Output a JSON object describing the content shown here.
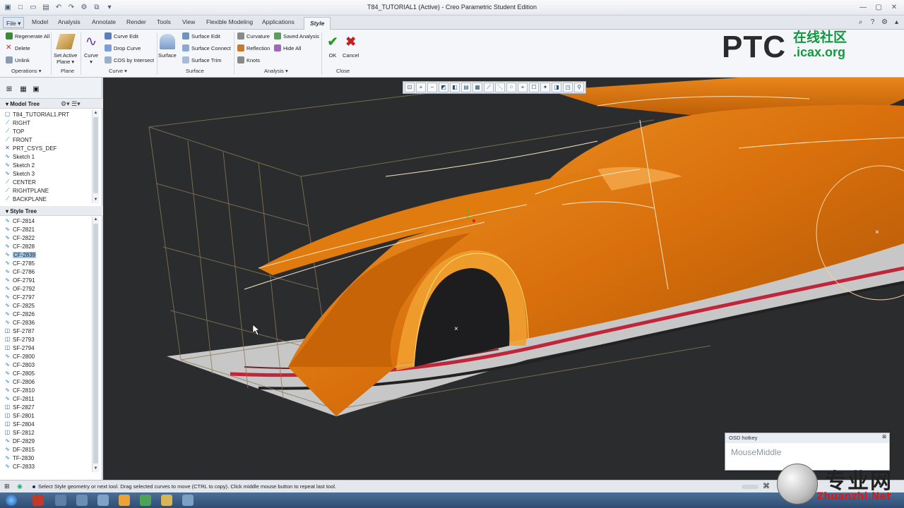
{
  "window": {
    "title": "T84_TUTORIAL1 (Active) - Creo Parametric Student Edition"
  },
  "tabs": [
    "File",
    "Model",
    "Analysis",
    "Annotate",
    "Render",
    "Tools",
    "View",
    "Flexible Modeling",
    "Applications",
    "Style"
  ],
  "active_tab": "Style",
  "ribbon": {
    "operations": {
      "label": "Operations",
      "items": [
        "Regenerate All",
        "Delete",
        "Unlink"
      ]
    },
    "plane": {
      "label": "Plane",
      "set_active": "Set Active",
      "set_active2": "Plane"
    },
    "curve": {
      "label": "Curve",
      "big": "Curve",
      "items": [
        "Curve Edit",
        "Drop Curve",
        "COS by Intersect"
      ]
    },
    "surface": {
      "label": "Surface",
      "big": "Surface",
      "items": [
        "Surface Edit",
        "Surface Connect",
        "Surface Trim"
      ]
    },
    "analysis": {
      "label": "Analysis",
      "items": [
        "Curvature",
        "Saved Analysis",
        "Reflection",
        "Hide All",
        "Knots"
      ]
    },
    "close": {
      "label": "Close",
      "ok": "OK",
      "cancel": "Cancel"
    }
  },
  "logo": {
    "ptc": "PTC",
    "cn1": "在线社区",
    "cn2": ".icax.org"
  },
  "model_tree": {
    "title": "Model Tree",
    "items": [
      "T84_TUTORIAL1.PRT",
      "RIGHT",
      "TOP",
      "FRONT",
      "PRT_CSYS_DEF",
      "Sketch 1",
      "Sketch 2",
      "Sketch 3",
      "CENTER",
      "RIGHTPLANE",
      "BACKPLANE"
    ]
  },
  "style_tree": {
    "title": "Style Tree",
    "selected": "CF-2839",
    "items": [
      "CF-2814",
      "CF-2821",
      "CF-2822",
      "CF-2828",
      "CF-2839",
      "CF-2785",
      "CF-2786",
      "OF-2791",
      "OF-2792",
      "CF-2797",
      "CF-2825",
      "CF-2826",
      "CF-2836",
      "SF-2787",
      "SF-2793",
      "SF-2794",
      "CF-2800",
      "CF-2803",
      "CF-2805",
      "CF-2806",
      "CF-2810",
      "CF-2811",
      "SF-2827",
      "SF-2801",
      "SF-2804",
      "SF-2812",
      "DF-2829",
      "DF-2815",
      "TF-2830",
      "CF-2833"
    ]
  },
  "osd": {
    "title": "OSD hotkey",
    "value": "MouseMiddle"
  },
  "status": {
    "message": "Select Style geometry or next tool. Drag selected curves to move (CTRL to copy). Click middle mouse button to repeat last tool."
  },
  "watermark": {
    "cn": "专业网",
    "net": "Zhuanzhi.Net"
  },
  "colors": {
    "surface": "#e07b10",
    "viewport": "#2b2c2e",
    "accent": "#1d65b8"
  }
}
